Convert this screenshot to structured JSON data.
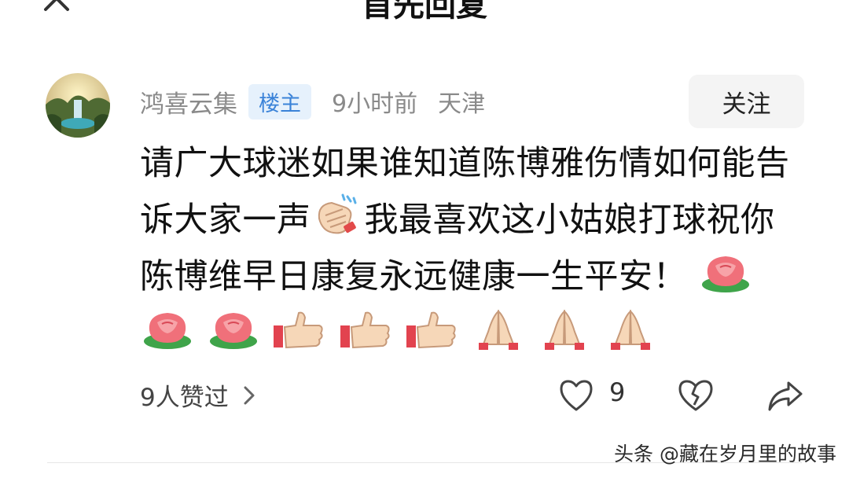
{
  "header": {
    "title": "首先回复",
    "close_icon": "close-icon"
  },
  "comment": {
    "avatar_icon": "landscape-avatar",
    "username": "鸿喜云集",
    "badge": "楼主",
    "time": "9小时前",
    "location": "天津",
    "follow_label": "关注",
    "text_part1": "请广大球迷如果谁知道陈博雅伤情如何能告诉大家一声",
    "text_part2": "我最喜欢这小姑娘打球祝你陈博维早日康复永远健康一生平安！",
    "emojis": [
      "clapping-hands",
      "rose",
      "rose",
      "rose",
      "thumbs-up",
      "thumbs-up",
      "thumbs-up",
      "folded-hands",
      "folded-hands",
      "folded-hands"
    ],
    "likes_label": "9人赞过",
    "heart_count": "9"
  },
  "watermark": "头条 @藏在岁月里的故事",
  "colors": {
    "badge_bg": "#e6f1fc",
    "badge_text": "#3a82d8",
    "meta_gray": "#8a8a8a",
    "follow_bg": "#f4f4f4"
  }
}
